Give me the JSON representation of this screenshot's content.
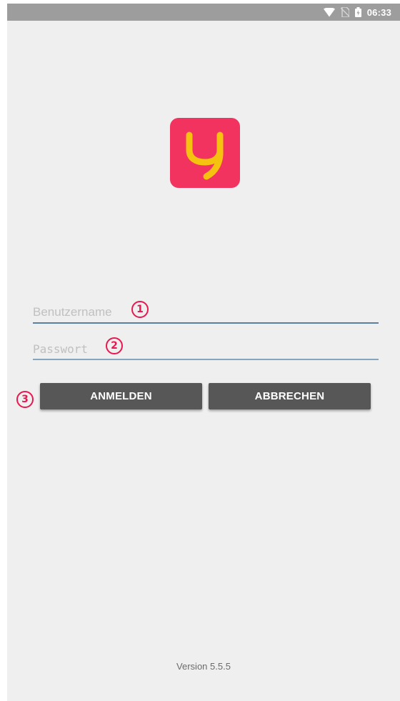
{
  "status_bar": {
    "time": "06:33",
    "icons": [
      "wifi-icon",
      "no-sim-icon",
      "battery-icon"
    ]
  },
  "logo": {
    "name": "app-logo",
    "background": "#f2335f",
    "glyph_color": "#f5c20f"
  },
  "login_form": {
    "username": {
      "placeholder": "Benutzername",
      "value": ""
    },
    "password": {
      "placeholder": "Passwort",
      "value": ""
    },
    "login_button": "ANMELDEN",
    "cancel_button": "ABBRECHEN"
  },
  "annotations": {
    "marker1": "1",
    "marker2": "2",
    "marker3": "3"
  },
  "footer": {
    "version": "Version 5.5.5"
  },
  "colors": {
    "screen_bg": "#efefef",
    "status_bar": "#9d9d9d",
    "button_bg": "#575757",
    "field_underline": "#5a7fa1",
    "annotation": "#e8174f"
  }
}
